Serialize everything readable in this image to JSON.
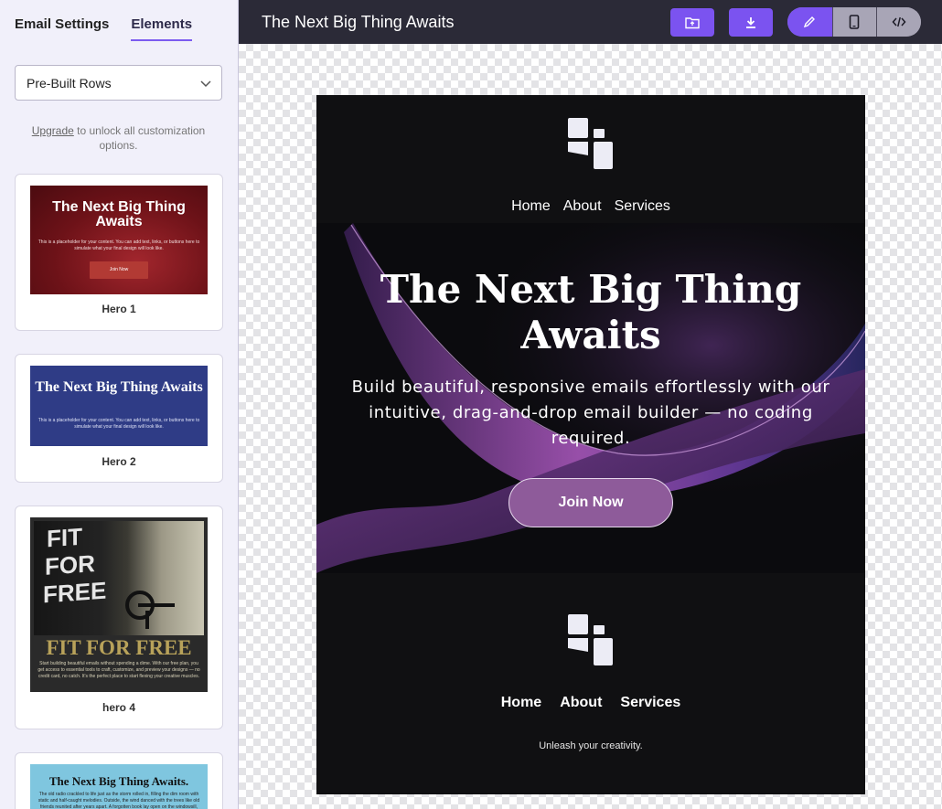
{
  "sidebar": {
    "tabs": [
      {
        "label": "Email Settings",
        "active": false
      },
      {
        "label": "Elements",
        "active": true
      }
    ],
    "select": {
      "value": "Pre-Built Rows",
      "icon": "chevron-down-icon"
    },
    "upgrade": {
      "link": "Upgrade",
      "text": "to unlock all customization options."
    },
    "cards": [
      {
        "label": "Hero 1",
        "thumb_title": "The Next Big Thing Awaits",
        "thumb_body": "This is a placeholder for your content. You can add text, links, or buttons here to simulate what your final design will look like.",
        "thumb_button": "Join Now"
      },
      {
        "label": "Hero 2",
        "thumb_title": "The Next Big Thing Awaits",
        "thumb_body": "This is a placeholder for your content. You can add text, links, or buttons here to simulate what your final design will look like."
      },
      {
        "label": "hero 4",
        "thumb_words": [
          "FIT",
          "FOR",
          "FREE"
        ],
        "thumb_title": "FIT FOR FREE",
        "thumb_body": "Start building beautiful emails without spending a dime. With our free plan, you get access to essential tools to craft, customize, and preview your designs — no credit card, no catch. It's the perfect place to start flexing your creative muscles."
      },
      {
        "thumb_title": "The Next Big Thing Awaits.",
        "thumb_body": "The old radio crackled to life just as the storm rolled in, filling the dim room with static and half-caught melodies. Outside, the wind danced with the trees like old friends reunited after years apart. A forgotten book lay open on the windowsill,"
      }
    ]
  },
  "topbar": {
    "title": "The Next Big Thing Awaits",
    "buttons": [
      {
        "name": "save-folder-button",
        "icon": "folder-icon"
      },
      {
        "name": "download-button",
        "icon": "download-icon"
      }
    ],
    "view_modes": [
      {
        "name": "edit-mode",
        "icon": "pencil-icon",
        "active": true
      },
      {
        "name": "mobile-preview",
        "icon": "mobile-icon",
        "active": false
      },
      {
        "name": "code-view",
        "icon": "code-icon",
        "active": false
      }
    ],
    "accent": "#7b53f0"
  },
  "email": {
    "nav_top": [
      "Home",
      "About",
      "Services"
    ],
    "hero": {
      "title": "The Next Big Thing Awaits",
      "subtitle": "Build beautiful, responsive emails effortlessly with our intuitive, drag-and-drop email builder — no coding required.",
      "button": "Join Now",
      "button_color": "#8e5b9a"
    },
    "nav_bottom": [
      "Home",
      "About",
      "Services"
    ],
    "tagline": "Unleash your creativity.",
    "background": "#101012"
  }
}
